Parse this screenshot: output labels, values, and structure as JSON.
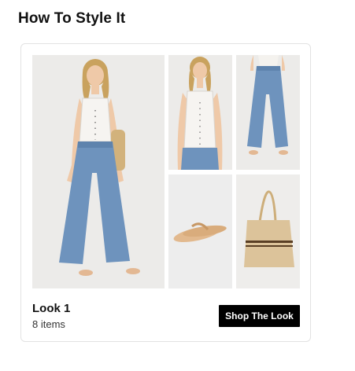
{
  "section": {
    "title": "How To Style It"
  },
  "look": {
    "title": "Look 1",
    "count": "8 items",
    "shop_label": "Shop The Look"
  },
  "images": [
    {
      "name": "model-full-outfit-image",
      "subject": "model in white tank top and wide-leg jeans"
    },
    {
      "name": "tank-top-image",
      "subject": "white crochet tank top"
    },
    {
      "name": "jeans-image",
      "subject": "wide-leg jeans"
    },
    {
      "name": "sandals-image",
      "subject": "tan flip-flop sandals"
    },
    {
      "name": "tote-bag-image",
      "subject": "straw tote bag"
    }
  ],
  "colors": {
    "button_bg": "#000000",
    "button_text": "#ffffff",
    "denim": "#6e93bd",
    "image_bg": "#ecebe9"
  }
}
